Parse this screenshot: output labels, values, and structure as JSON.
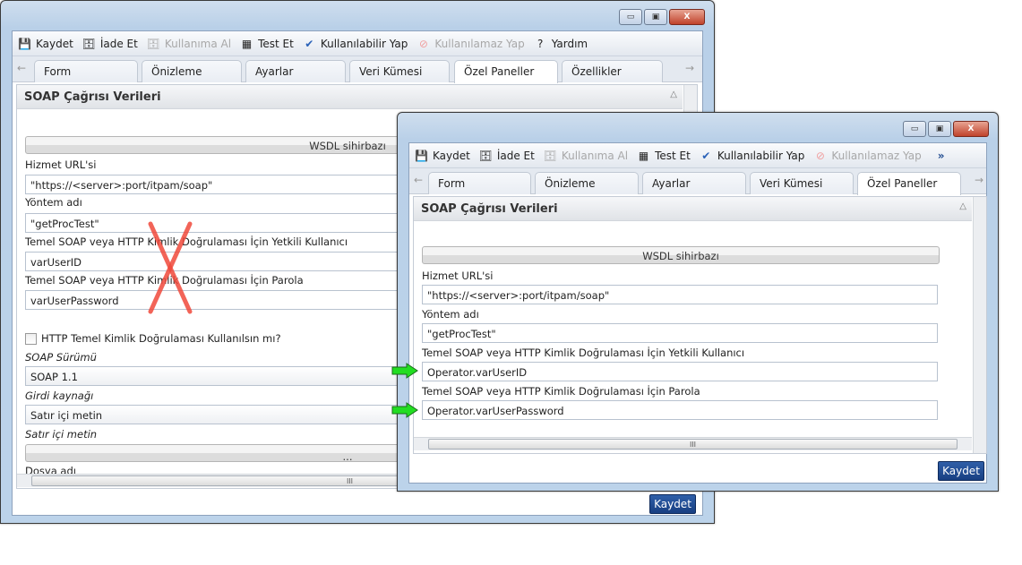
{
  "toolbar": {
    "save": "Kaydet",
    "checkin": "İade Et",
    "checkout": "Kullanıma Al",
    "test": "Test Et",
    "enable": "Kullanılabilir Yap",
    "disable": "Kullanılamaz Yap",
    "help": "Yardım",
    "more": "»"
  },
  "tabs": [
    "Form",
    "Önizleme",
    "Ayarlar",
    "Veri Kümesi",
    "Özel Paneller",
    "Özellikler"
  ],
  "panel_title": "SOAP Çağrısı Verileri",
  "wsdl_button": "WSDL sihirbazı",
  "labels": {
    "url": "Hizmet URL'si",
    "method": "Yöntem adı",
    "user": "Temel SOAP veya HTTP Kimlik Doğrulaması İçin Yetkili Kullanıcı",
    "pass": "Temel SOAP veya HTTP Kimlik Doğrulaması İçin Parola",
    "http_auth": "HTTP Temel Kimlik Doğrulaması Kullanılsın mı?",
    "soap_version": "SOAP Sürümü",
    "input_source": "Girdi kaynağı",
    "inline_text": "Satır içi metin",
    "file_name": "Dosya adı"
  },
  "back": {
    "url": "\"https://<server>:port/itpam/soap\"",
    "method": "\"getProcTest\"",
    "user": "varUserID",
    "pass": "varUserPassword",
    "soap_version": "SOAP 1.1",
    "input_source": "Satır içi metin",
    "ellipsis": "..."
  },
  "front": {
    "url": "\"https://<server>:port/itpam/soap\"",
    "method": "\"getProcTest\"",
    "user": "Operator.varUserID",
    "pass": "Operator.varUserPassword"
  },
  "save_button": "Kaydet",
  "scroll_grip": "III",
  "colors": {
    "accent": "#1f4a8f",
    "wrong": "#f0493c",
    "correct": "#22dd22"
  }
}
